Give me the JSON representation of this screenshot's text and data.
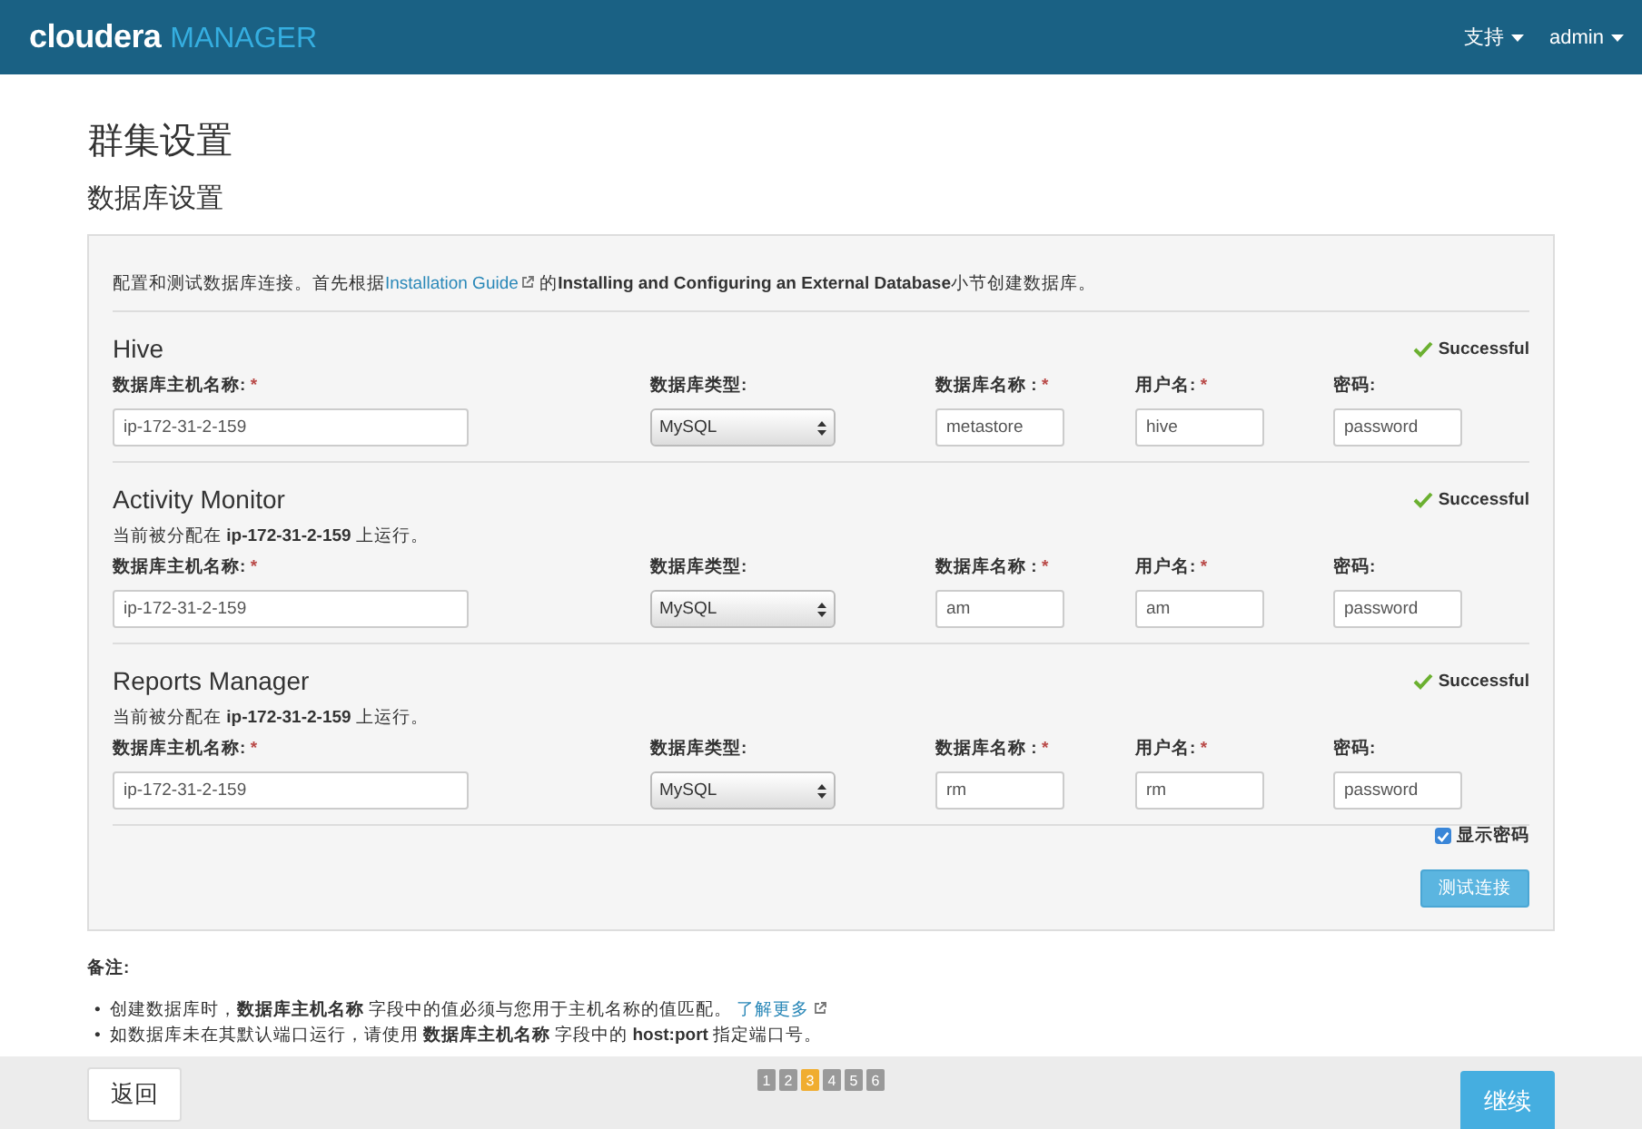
{
  "header": {
    "brand": "cloudera",
    "product": "MANAGER",
    "menus": [
      {
        "label": "支持"
      },
      {
        "label": "admin"
      }
    ]
  },
  "page_title": "群集设置",
  "section_title": "数据库设置",
  "intro": {
    "before": "配置和测试数据库连接。首先根据",
    "link": "Installation Guide",
    "after": "的**Installing and Configuring an External Database**小节创建数据库。"
  },
  "databases": [
    {
      "name": "Hive",
      "status": {
        "kind": "success",
        "text": "Successful"
      },
      "fields": [
        {
          "kind": "text",
          "label": "数据库主机名称:",
          "required_mark": "*",
          "value": "ip-172-31-2-159"
        },
        {
          "kind": "select",
          "label": "数据库类型:",
          "value": "MySQL"
        },
        {
          "kind": "text",
          "label": "数据库名称 :",
          "required_mark": "*",
          "value": "metastore"
        },
        {
          "kind": "text",
          "label": "用户名:",
          "required_mark": "*",
          "value": "hive"
        },
        {
          "kind": "text",
          "label": "密码:",
          "value": "password"
        }
      ]
    },
    {
      "name": "Activity Monitor",
      "status": {
        "kind": "success",
        "text": "Successful"
      },
      "assigned": "当前被分配在 **ip-172-31-2-159** 上运行。",
      "fields": [
        {
          "kind": "text",
          "label": "数据库主机名称:",
          "required_mark": "*",
          "value": "ip-172-31-2-159"
        },
        {
          "kind": "select",
          "label": "数据库类型:",
          "value": "MySQL"
        },
        {
          "kind": "text",
          "label": "数据库名称 :",
          "required_mark": "*",
          "value": "am"
        },
        {
          "kind": "text",
          "label": "用户名:",
          "required_mark": "*",
          "value": "am"
        },
        {
          "kind": "text",
          "label": "密码:",
          "value": "password"
        }
      ]
    },
    {
      "name": "Reports Manager",
      "status": {
        "kind": "success",
        "text": "Successful"
      },
      "assigned": "当前被分配在 **ip-172-31-2-159** 上运行。",
      "fields": [
        {
          "kind": "text",
          "label": "数据库主机名称:",
          "required_mark": "*",
          "value": "ip-172-31-2-159"
        },
        {
          "kind": "select",
          "label": "数据库类型:",
          "value": "MySQL"
        },
        {
          "kind": "text",
          "label": "数据库名称 :",
          "required_mark": "*",
          "value": "rm"
        },
        {
          "kind": "text",
          "label": "用户名:",
          "required_mark": "*",
          "value": "rm"
        },
        {
          "kind": "text",
          "label": "密码:",
          "value": "password"
        }
      ]
    }
  ],
  "show_password": {
    "label": "显示密码",
    "checked": true
  },
  "test_button": "测试连接",
  "notes": {
    "title": "备注:",
    "items": [
      {
        "marker": "•",
        "text": "创建数据库时，**数据库主机名称** 字段中的值必须与您用于主机名称的值匹配。",
        "link": "了解更多"
      },
      {
        "marker": "•",
        "text": "如数据库未在其默认端口运行，请使用 **数据库主机名称** 字段中的 **host:port** 指定端口号。"
      }
    ]
  },
  "footer": {
    "back": "返回",
    "steps": [
      {
        "label": "1",
        "selected": false
      },
      {
        "label": "2",
        "selected": false
      },
      {
        "label": "3",
        "selected": true
      },
      {
        "label": "4",
        "selected": false
      },
      {
        "label": "5",
        "selected": false
      },
      {
        "label": "6",
        "selected": false
      }
    ],
    "next": "继续"
  }
}
